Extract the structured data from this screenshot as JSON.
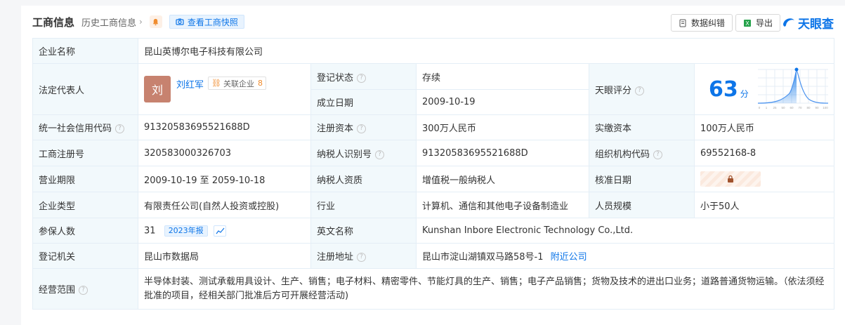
{
  "header": {
    "title": "工商信息",
    "history": "历史工商信息",
    "snapshot": "查看工商快照",
    "correction": "数据纠错",
    "export": "导出",
    "logo": "天眼查"
  },
  "rows": {
    "company_name": {
      "label": "企业名称",
      "value": "昆山英博尔电子科技有限公司"
    },
    "legal_rep": {
      "label": "法定代表人",
      "avatar": "刘",
      "name": "刘红军",
      "related_label": "关联企业",
      "related_count": "8"
    },
    "reg_status": {
      "label": "登记状态",
      "value": "存续"
    },
    "founded": {
      "label": "成立日期",
      "value": "2009-10-19"
    },
    "score": {
      "label": "天眼评分",
      "value": "63",
      "unit": "分",
      "axis": [
        "0",
        "1",
        "25",
        "50",
        "60",
        "70",
        "80",
        "90",
        "100"
      ]
    },
    "credit_code": {
      "label": "统一社会信用代码",
      "value": "91320583695521688D"
    },
    "reg_capital": {
      "label": "注册资本",
      "value": "300万人民币"
    },
    "paid_capital": {
      "label": "实缴资本",
      "value": "100万人民币"
    },
    "reg_no": {
      "label": "工商注册号",
      "value": "320583000326703"
    },
    "taxpayer_id": {
      "label": "纳税人识别号",
      "value": "91320583695521688D"
    },
    "org_code": {
      "label": "组织机构代码",
      "value": "69552168-8"
    },
    "term": {
      "label": "营业期限",
      "value": "2009-10-19 至 2059-10-18"
    },
    "taxpayer_qual": {
      "label": "纳税人资质",
      "value": "增值税一般纳税人"
    },
    "approval_date": {
      "label": "核准日期"
    },
    "company_type": {
      "label": "企业类型",
      "value": "有限责任公司(自然人投资或控股)"
    },
    "industry": {
      "label": "行业",
      "value": "计算机、通信和其他电子设备制造业"
    },
    "staff_size": {
      "label": "人员规模",
      "value": "小于50人"
    },
    "insured": {
      "label": "参保人数",
      "value": "31",
      "year_tag": "2023年报"
    },
    "english_name": {
      "label": "英文名称",
      "value": "Kunshan Inbore Electronic Technology Co.,Ltd."
    },
    "authority": {
      "label": "登记机关",
      "value": "昆山市数据局"
    },
    "address": {
      "label": "注册地址",
      "value": "昆山市淀山湖镇双马路58号-1",
      "nearby": "附近公司"
    },
    "scope": {
      "label": "经营范围",
      "value": "半导体封装、测试承载用具设计、生产、销售；电子材料、精密零件、节能灯具的生产、销售；电子产品销售；货物及技术的进出口业务；道路普通货物运输。（依法须经批准的项目，经相关部门批准后方可开展经营活动)"
    }
  },
  "colors": {
    "accent": "#0d75e8",
    "status_green": "#24a24a",
    "label_bg": "#f2f9fc"
  }
}
